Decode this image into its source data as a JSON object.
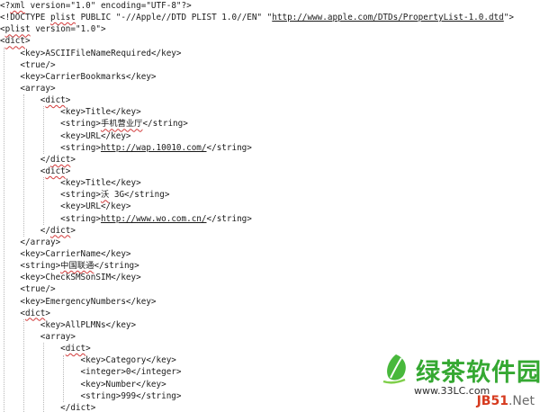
{
  "editor": {
    "colors": {
      "text": "#1a1a1a",
      "spellcheck": "#d23a3a",
      "guide": "#b8b8b8"
    },
    "lines": [
      [
        {
          "t": "<?"
        },
        {
          "t": "xml",
          "s": "squig"
        },
        {
          "t": " version=\"1.0\" encoding=\"UTF-8\"?>"
        }
      ],
      [
        {
          "t": "<!DOCTYPE "
        },
        {
          "t": "plist",
          "s": "squig"
        },
        {
          "t": " PUBLIC \"-//Apple//DTD PLIST 1.0//EN\" \""
        },
        {
          "t": "http://www.apple.com/DTDs/PropertyList-1.0.dtd",
          "s": "url"
        },
        {
          "t": "\">"
        }
      ],
      [
        {
          "t": "<"
        },
        {
          "t": "plist",
          "s": "squig"
        },
        {
          "t": " version=\"1.0\">"
        }
      ],
      [
        {
          "t": "<"
        },
        {
          "t": "dict",
          "s": "squig"
        },
        {
          "t": ">"
        }
      ],
      [
        {
          "t": "    <key>ASCIIFileNameRequired</key>"
        }
      ],
      [
        {
          "t": "    <true/>"
        }
      ],
      [
        {
          "t": "    <key>CarrierBookmarks</key>"
        }
      ],
      [
        {
          "t": "    <array>"
        }
      ],
      [
        {
          "t": "        <"
        },
        {
          "t": "dict",
          "s": "squig"
        },
        {
          "t": ">"
        }
      ],
      [
        {
          "t": "            <key>Title</key>"
        }
      ],
      [
        {
          "t": "            <string>"
        },
        {
          "t": "手机营业厅",
          "s": "squig"
        },
        {
          "t": "</string>"
        }
      ],
      [
        {
          "t": "            <key>URL</key>"
        }
      ],
      [
        {
          "t": "            <string>"
        },
        {
          "t": "http://wap.10010.com/",
          "s": "url"
        },
        {
          "t": "</string>"
        }
      ],
      [
        {
          "t": "        </"
        },
        {
          "t": "dict",
          "s": "squig"
        },
        {
          "t": ">"
        }
      ],
      [
        {
          "t": "        <"
        },
        {
          "t": "dict",
          "s": "squig"
        },
        {
          "t": ">"
        }
      ],
      [
        {
          "t": "            <key>Title</key>"
        }
      ],
      [
        {
          "t": "            <string>"
        },
        {
          "t": "沃",
          "s": "squig"
        },
        {
          "t": " 3G</string>"
        }
      ],
      [
        {
          "t": "            <key>URL</key>"
        }
      ],
      [
        {
          "t": "            <string>"
        },
        {
          "t": "http://www.wo.com.cn/",
          "s": "url"
        },
        {
          "t": "</string>"
        }
      ],
      [
        {
          "t": "        </"
        },
        {
          "t": "dict",
          "s": "squig"
        },
        {
          "t": ">"
        }
      ],
      [
        {
          "t": "    </array>"
        }
      ],
      [
        {
          "t": "    <key>CarrierName</key>"
        }
      ],
      [
        {
          "t": "    <string>"
        },
        {
          "t": "中国联通",
          "s": "squig"
        },
        {
          "t": "</string>"
        }
      ],
      [
        {
          "t": "    <key>CheckSMSonSIM</key>"
        }
      ],
      [
        {
          "t": "    <true/>"
        }
      ],
      [
        {
          "t": "    <key>EmergencyNumbers</key>"
        }
      ],
      [
        {
          "t": "    <"
        },
        {
          "t": "dict",
          "s": "squig"
        },
        {
          "t": ">"
        }
      ],
      [
        {
          "t": "        <key>AllPLMNs</key>"
        }
      ],
      [
        {
          "t": "        <array>"
        }
      ],
      [
        {
          "t": "            <"
        },
        {
          "t": "dict",
          "s": "squig"
        },
        {
          "t": ">"
        }
      ],
      [
        {
          "t": "                <key>Category</key>"
        }
      ],
      [
        {
          "t": "                <integer>0</integer>"
        }
      ],
      [
        {
          "t": "                <key>Number</key>"
        }
      ],
      [
        {
          "t": "                <string>999</string>"
        }
      ],
      [
        {
          "t": "            </"
        },
        {
          "t": "dict",
          "s": "squig"
        },
        {
          "t": ">"
        }
      ]
    ]
  },
  "watermark": {
    "brand": "绿茶软件园",
    "url": "www.33LC.com",
    "jb51_a": "JB51",
    "jb51_dot": ".",
    "jb51_b": "Net",
    "brand_color": "#35a832"
  }
}
